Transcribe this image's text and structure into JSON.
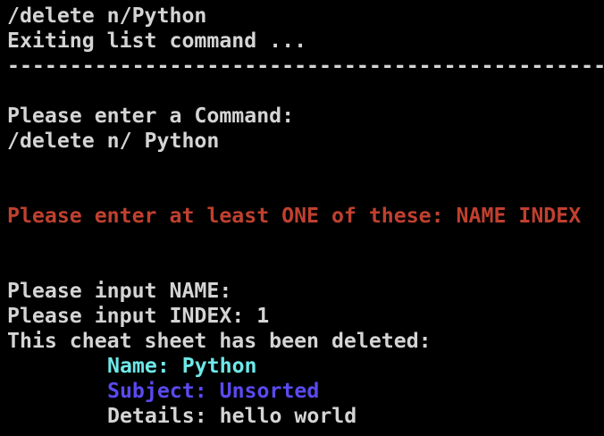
{
  "lines": {
    "l1": "/delete n/Python",
    "l2": "Exiting list command ...",
    "l3": "------------------------------------------------------------",
    "l5": "Please enter a Command:",
    "l6": "/delete n/ Python",
    "l9": "Please enter at least ONE of these: NAME INDEX",
    "l12": "Please input NAME:",
    "l13": "Please input INDEX: 1",
    "l14": "This cheat sheet has been deleted:",
    "l15": "Name: Python",
    "l16": "Subject: Unsorted",
    "l17": "Details: hello world"
  },
  "colors": {
    "error": "#c0402f",
    "name": "#6ee8e8",
    "subject": "#5a4af0",
    "text": "#d4d4d4"
  }
}
